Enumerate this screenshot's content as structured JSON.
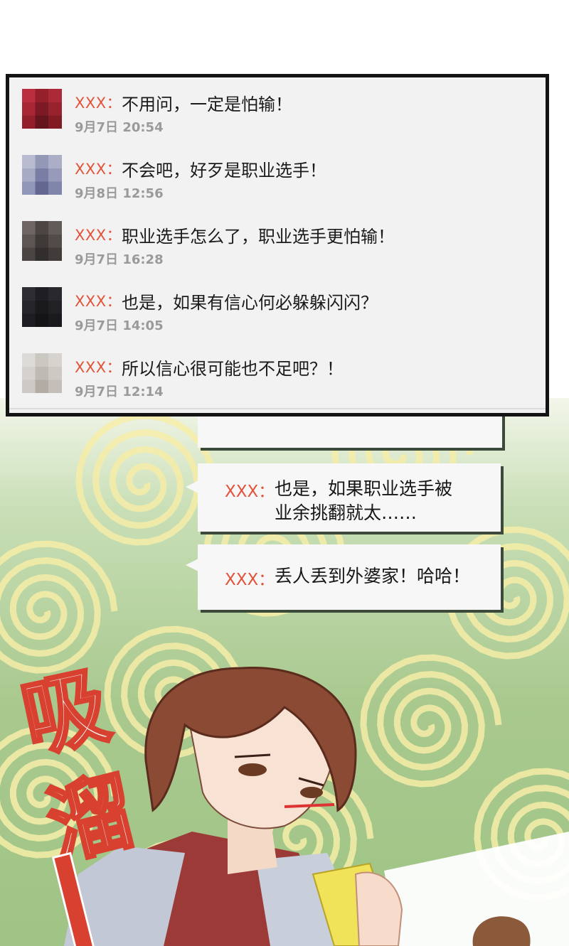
{
  "comments": [
    {
      "name": "XXX",
      "sep": "：",
      "text": "不用问，一定是怕输！",
      "time": "9月7日 20:54",
      "avatar_color": "#8c1f2a"
    },
    {
      "name": "XXX",
      "sep": "：",
      "text": "不会吧，好歹是职业选手！",
      "time": "9月8日 12:56",
      "avatar_color": "#8b8fb0"
    },
    {
      "name": "XXX",
      "sep": "：",
      "text": "职业选手怎么了，职业选手更怕输！",
      "time": "9月7日 16:28",
      "avatar_color": "#4a4442"
    },
    {
      "name": "XXX",
      "sep": "：",
      "text": "也是，如果有信心何必躲躲闪闪？",
      "time": "9月7日 14:05",
      "avatar_color": "#1e1e22"
    },
    {
      "name": "XXX",
      "sep": "：",
      "text": "所以信心很可能也不足吧？！",
      "time": "9月7日 12:14",
      "avatar_color": "#c7c3bd"
    }
  ],
  "bubbles": [
    {
      "name": "XXX：",
      "line1": "也是，如果职业选手被",
      "line2": "业余挑翻就太……"
    },
    {
      "name": "XXX：",
      "line1": "丢人丢到外婆家！哈哈！"
    }
  ],
  "sfx": {
    "char1": "吸",
    "char2": "溜"
  }
}
